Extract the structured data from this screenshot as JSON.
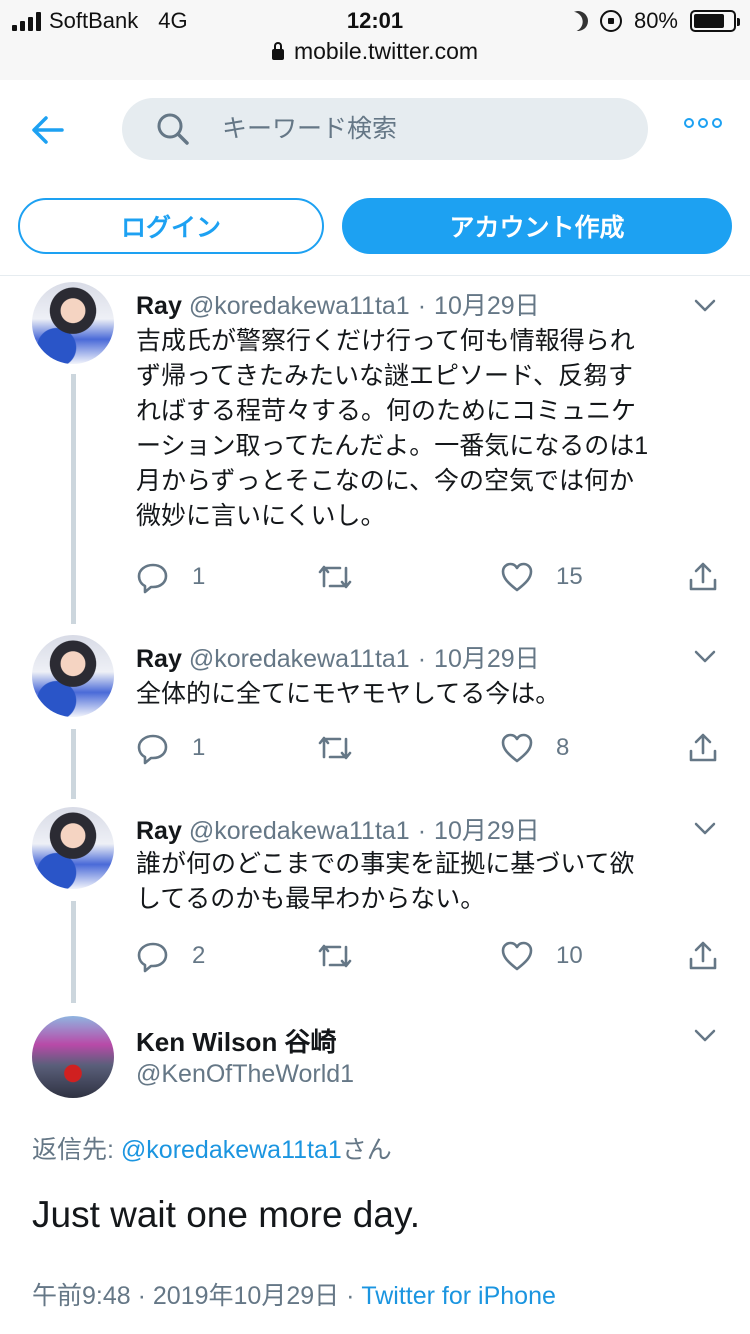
{
  "status_bar": {
    "carrier": "SoftBank",
    "network": "4G",
    "time": "12:01",
    "battery": "80%",
    "battery_level": 0.8
  },
  "browser": {
    "url": "mobile.twitter.com"
  },
  "header": {
    "search_placeholder": "キーワード検索",
    "login_label": "ログイン",
    "signup_label": "アカウント作成"
  },
  "colors": {
    "accent": "#1da1f2",
    "secondary_text": "#657786",
    "thread_line": "#ccd6dd"
  },
  "tweets": [
    {
      "name": "Ray",
      "handle": "@koredakewa11ta1",
      "date": "10月29日",
      "lines": [
        "吉成氏が警察行くだけ行って何も情報得られ",
        "ず帰ってきたみたいな謎エピソード、反芻す",
        "ればする程苛々する。何のためにコミュニケ",
        "ーション取ってたんだよ。一番気になるのは1",
        "月からずっとそこなのに、今の空気では何か",
        "微妙に言いにくいし。"
      ],
      "replies": "1",
      "retweets": "",
      "likes": "15"
    },
    {
      "name": "Ray",
      "handle": "@koredakewa11ta1",
      "date": "10月29日",
      "lines": [
        "全体的に全てにモヤモヤしてる今は。"
      ],
      "replies": "1",
      "retweets": "",
      "likes": "8"
    },
    {
      "name": "Ray",
      "handle": "@koredakewa11ta1",
      "date": "10月29日",
      "lines": [
        "誰が何のどこまでの事実を証拠に基づいて欲",
        "してるのかも最早わからない。"
      ],
      "replies": "2",
      "retweets": "",
      "likes": "10"
    }
  ],
  "main_tweet": {
    "name": "Ken Wilson 谷崎",
    "handle": "@KenOfTheWorld1",
    "reply_prefix": "返信先: ",
    "reply_handle": "@koredakewa11ta1",
    "reply_suffix": "さん",
    "text": "Just wait one more day.",
    "time": "午前9:48",
    "date": "2019年10月29日",
    "source": "Twitter for iPhone"
  }
}
